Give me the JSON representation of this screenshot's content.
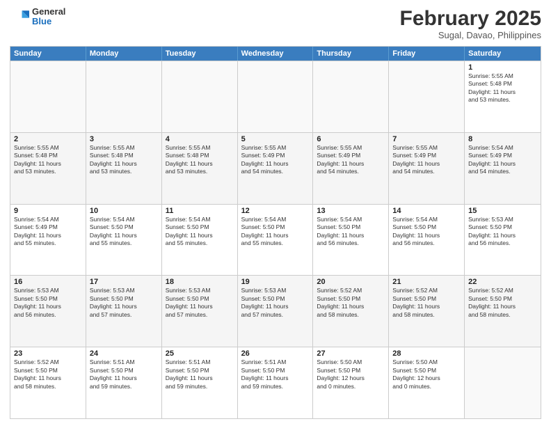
{
  "header": {
    "logo": {
      "general": "General",
      "blue": "Blue"
    },
    "title": "February 2025",
    "subtitle": "Sugal, Davao, Philippines"
  },
  "calendar": {
    "days": [
      "Sunday",
      "Monday",
      "Tuesday",
      "Wednesday",
      "Thursday",
      "Friday",
      "Saturday"
    ],
    "rows": [
      [
        {
          "day": "",
          "text": ""
        },
        {
          "day": "",
          "text": ""
        },
        {
          "day": "",
          "text": ""
        },
        {
          "day": "",
          "text": ""
        },
        {
          "day": "",
          "text": ""
        },
        {
          "day": "",
          "text": ""
        },
        {
          "day": "1",
          "text": "Sunrise: 5:55 AM\nSunset: 5:48 PM\nDaylight: 11 hours\nand 53 minutes."
        }
      ],
      [
        {
          "day": "2",
          "text": "Sunrise: 5:55 AM\nSunset: 5:48 PM\nDaylight: 11 hours\nand 53 minutes."
        },
        {
          "day": "3",
          "text": "Sunrise: 5:55 AM\nSunset: 5:48 PM\nDaylight: 11 hours\nand 53 minutes."
        },
        {
          "day": "4",
          "text": "Sunrise: 5:55 AM\nSunset: 5:48 PM\nDaylight: 11 hours\nand 53 minutes."
        },
        {
          "day": "5",
          "text": "Sunrise: 5:55 AM\nSunset: 5:49 PM\nDaylight: 11 hours\nand 54 minutes."
        },
        {
          "day": "6",
          "text": "Sunrise: 5:55 AM\nSunset: 5:49 PM\nDaylight: 11 hours\nand 54 minutes."
        },
        {
          "day": "7",
          "text": "Sunrise: 5:55 AM\nSunset: 5:49 PM\nDaylight: 11 hours\nand 54 minutes."
        },
        {
          "day": "8",
          "text": "Sunrise: 5:54 AM\nSunset: 5:49 PM\nDaylight: 11 hours\nand 54 minutes."
        }
      ],
      [
        {
          "day": "9",
          "text": "Sunrise: 5:54 AM\nSunset: 5:49 PM\nDaylight: 11 hours\nand 55 minutes."
        },
        {
          "day": "10",
          "text": "Sunrise: 5:54 AM\nSunset: 5:50 PM\nDaylight: 11 hours\nand 55 minutes."
        },
        {
          "day": "11",
          "text": "Sunrise: 5:54 AM\nSunset: 5:50 PM\nDaylight: 11 hours\nand 55 minutes."
        },
        {
          "day": "12",
          "text": "Sunrise: 5:54 AM\nSunset: 5:50 PM\nDaylight: 11 hours\nand 55 minutes."
        },
        {
          "day": "13",
          "text": "Sunrise: 5:54 AM\nSunset: 5:50 PM\nDaylight: 11 hours\nand 56 minutes."
        },
        {
          "day": "14",
          "text": "Sunrise: 5:54 AM\nSunset: 5:50 PM\nDaylight: 11 hours\nand 56 minutes."
        },
        {
          "day": "15",
          "text": "Sunrise: 5:53 AM\nSunset: 5:50 PM\nDaylight: 11 hours\nand 56 minutes."
        }
      ],
      [
        {
          "day": "16",
          "text": "Sunrise: 5:53 AM\nSunset: 5:50 PM\nDaylight: 11 hours\nand 56 minutes."
        },
        {
          "day": "17",
          "text": "Sunrise: 5:53 AM\nSunset: 5:50 PM\nDaylight: 11 hours\nand 57 minutes."
        },
        {
          "day": "18",
          "text": "Sunrise: 5:53 AM\nSunset: 5:50 PM\nDaylight: 11 hours\nand 57 minutes."
        },
        {
          "day": "19",
          "text": "Sunrise: 5:53 AM\nSunset: 5:50 PM\nDaylight: 11 hours\nand 57 minutes."
        },
        {
          "day": "20",
          "text": "Sunrise: 5:52 AM\nSunset: 5:50 PM\nDaylight: 11 hours\nand 58 minutes."
        },
        {
          "day": "21",
          "text": "Sunrise: 5:52 AM\nSunset: 5:50 PM\nDaylight: 11 hours\nand 58 minutes."
        },
        {
          "day": "22",
          "text": "Sunrise: 5:52 AM\nSunset: 5:50 PM\nDaylight: 11 hours\nand 58 minutes."
        }
      ],
      [
        {
          "day": "23",
          "text": "Sunrise: 5:52 AM\nSunset: 5:50 PM\nDaylight: 11 hours\nand 58 minutes."
        },
        {
          "day": "24",
          "text": "Sunrise: 5:51 AM\nSunset: 5:50 PM\nDaylight: 11 hours\nand 59 minutes."
        },
        {
          "day": "25",
          "text": "Sunrise: 5:51 AM\nSunset: 5:50 PM\nDaylight: 11 hours\nand 59 minutes."
        },
        {
          "day": "26",
          "text": "Sunrise: 5:51 AM\nSunset: 5:50 PM\nDaylight: 11 hours\nand 59 minutes."
        },
        {
          "day": "27",
          "text": "Sunrise: 5:50 AM\nSunset: 5:50 PM\nDaylight: 12 hours\nand 0 minutes."
        },
        {
          "day": "28",
          "text": "Sunrise: 5:50 AM\nSunset: 5:50 PM\nDaylight: 12 hours\nand 0 minutes."
        },
        {
          "day": "",
          "text": ""
        }
      ]
    ]
  }
}
